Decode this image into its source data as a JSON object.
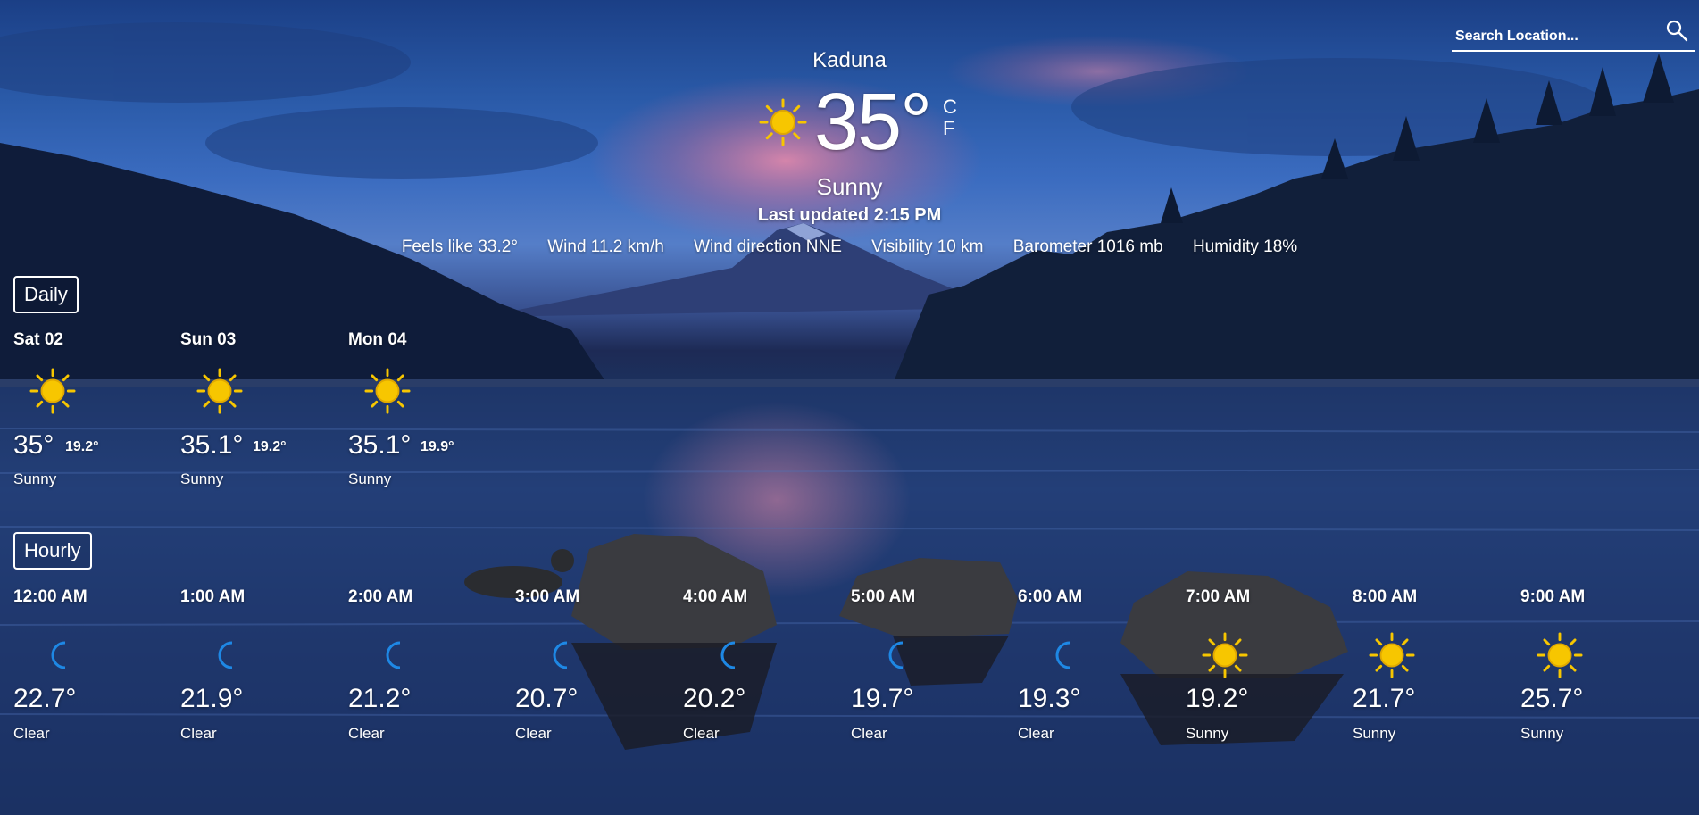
{
  "search": {
    "placeholder": "Search Location..."
  },
  "current": {
    "city": "Kaduna",
    "temperature": "35°",
    "unit_c": "C",
    "unit_f": "F",
    "condition": "Sunny",
    "updated": "Last updated 2:15 PM",
    "icon": "sun-icon",
    "details": {
      "feels_like": "Feels like 33.2°",
      "wind": "Wind 11.2 km/h",
      "wind_direction": "Wind direction NNE",
      "visibility": "Visibility 10 km",
      "barometer": "Barometer 1016 mb",
      "humidity": "Humidity 18%"
    }
  },
  "daily": {
    "label": "Daily",
    "days": [
      {
        "date": "Sat 02",
        "high": "35°",
        "low": "19.2°",
        "condition": "Sunny",
        "icon": "sun-icon"
      },
      {
        "date": "Sun 03",
        "high": "35.1°",
        "low": "19.2°",
        "condition": "Sunny",
        "icon": "sun-icon"
      },
      {
        "date": "Mon 04",
        "high": "35.1°",
        "low": "19.9°",
        "condition": "Sunny",
        "icon": "sun-icon"
      }
    ]
  },
  "hourly": {
    "label": "Hourly",
    "hours": [
      {
        "time": "12:00 AM",
        "temp": "22.7°",
        "condition": "Clear",
        "icon": "moon-icon"
      },
      {
        "time": "1:00 AM",
        "temp": "21.9°",
        "condition": "Clear",
        "icon": "moon-icon"
      },
      {
        "time": "2:00 AM",
        "temp": "21.2°",
        "condition": "Clear",
        "icon": "moon-icon"
      },
      {
        "time": "3:00 AM",
        "temp": "20.7°",
        "condition": "Clear",
        "icon": "moon-icon"
      },
      {
        "time": "4:00 AM",
        "temp": "20.2°",
        "condition": "Clear",
        "icon": "moon-icon"
      },
      {
        "time": "5:00 AM",
        "temp": "19.7°",
        "condition": "Clear",
        "icon": "moon-icon"
      },
      {
        "time": "6:00 AM",
        "temp": "19.3°",
        "condition": "Clear",
        "icon": "moon-icon"
      },
      {
        "time": "7:00 AM",
        "temp": "19.2°",
        "condition": "Sunny",
        "icon": "sun-icon"
      },
      {
        "time": "8:00 AM",
        "temp": "21.7°",
        "condition": "Sunny",
        "icon": "sun-icon"
      },
      {
        "time": "9:00 AM",
        "temp": "25.7°",
        "condition": "Sunny",
        "icon": "sun-icon"
      }
    ]
  },
  "colors": {
    "sun": "#f7c600",
    "moon": "#1e88e5",
    "text": "#ffffff"
  }
}
